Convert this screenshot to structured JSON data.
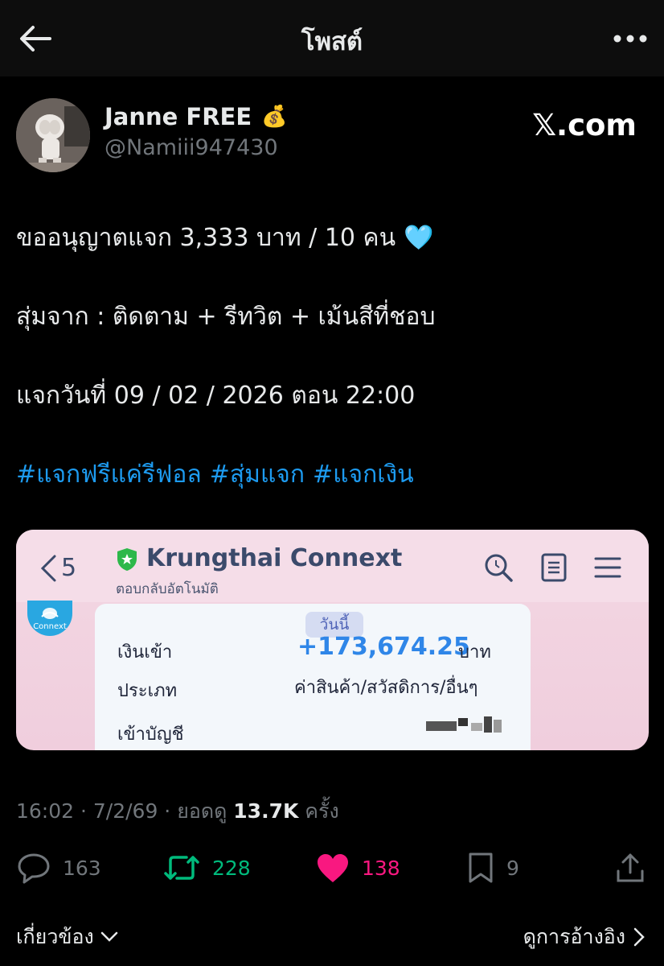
{
  "header": {
    "title": "โพสต์"
  },
  "post": {
    "author_name": "Janne FREE",
    "author_badge_emoji": "💰",
    "handle": "@Namiii947430",
    "brand": "𝕏.com",
    "line1": "ขออนุญาตแจก 3,333 บาท / 10 คน",
    "line1_emoji": "🩵",
    "line2": "สุ่มจาก : ติดตาม + รีทวิต + เม้นสีที่ชอบ",
    "line3": "แจกวันที่ 09 / 02 / 2026 ตอน 22:00",
    "hashtags": [
      "#แจกฟรีแค่รีฟอล",
      "#สุ่มแจก",
      "#แจกเงิน"
    ]
  },
  "image": {
    "back_count": "5",
    "app_title": "Krungthai Connext",
    "app_subtitle": "ตอบกลับอัตโนมัติ",
    "logo_text": "Connext",
    "today_tag": "วันนี้",
    "row1_label": "เงินเข้า",
    "amount": "+173,674.25",
    "currency": "บาท",
    "row2_label": "ประเภท",
    "category": "ค่าสินค้า/สวัสดิการ/อื่นๆ",
    "row3_label": "เข้าบัญชี"
  },
  "meta": {
    "time": "16:02 · 7/2/69 · ยอดดู ",
    "views": "13.7K",
    "views_suffix": " ครั้ง"
  },
  "actions": {
    "replies": "163",
    "reposts": "228",
    "likes": "138",
    "bookmarks": "9"
  },
  "footer": {
    "related": "เกี่ยวข้อง",
    "quotes": "ดูการอ้างอิง"
  },
  "colors": {
    "background": "#000000",
    "link": "#1d9bf0",
    "repost": "#00ba7c",
    "like": "#f91880",
    "muted": "#71767b"
  },
  "icons": [
    "back-arrow-icon",
    "more-icon",
    "money-bag-icon",
    "light-blue-heart-icon",
    "shield-star-icon",
    "search-icon",
    "document-icon",
    "menu-icon",
    "reply-icon",
    "repost-icon",
    "heart-icon",
    "bookmark-icon",
    "share-icon",
    "chevron-down-icon",
    "chevron-right-icon"
  ]
}
